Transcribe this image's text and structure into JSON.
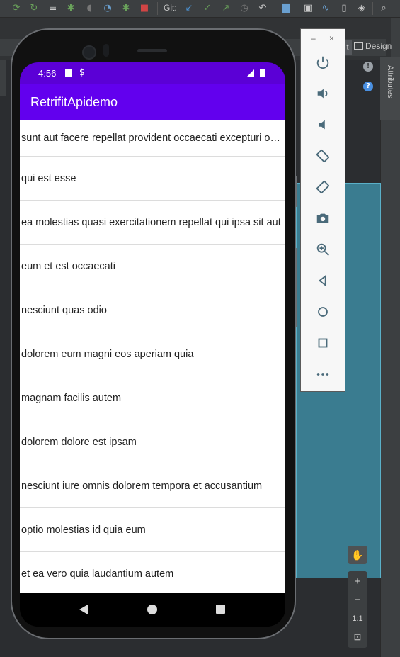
{
  "ide": {
    "git_label": "Git:",
    "design_tab_label": "Design",
    "split_tab_label": "t",
    "attributes_tab_label": "Attributes",
    "design_canvas_color": "#3a7c90",
    "zoom": {
      "plus": "+",
      "minus": "−",
      "one_to_one": "1:1"
    }
  },
  "emulator_controls": {
    "minimize": "–",
    "close": "×",
    "buttons": [
      "power-icon",
      "volume-up-icon",
      "volume-down-icon",
      "rotate-left-icon",
      "rotate-right-icon",
      "camera-icon",
      "zoom-icon",
      "back-icon",
      "home-icon",
      "overview-icon",
      "more-icon"
    ]
  },
  "device": {
    "status_time": "4:56",
    "app_title": "RetrifitApidemo",
    "accent": "#6200ee",
    "status_bar_color": "#5b00d6",
    "items": [
      "sunt aut facere repellat provident occaecati excepturi optio reprehenderit",
      "qui est esse",
      "ea molestias quasi exercitationem repellat qui ipsa sit aut",
      "eum et est occaecati",
      "nesciunt quas odio",
      "dolorem eum magni eos aperiam quia",
      "magnam facilis autem",
      "dolorem dolore est ipsam",
      "nesciunt iure omnis dolorem tempora et accusantium",
      "optio molestias id quia eum",
      "et ea vero quia laudantium autem"
    ]
  }
}
